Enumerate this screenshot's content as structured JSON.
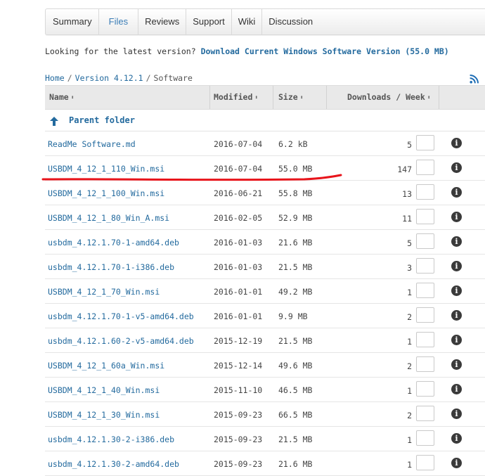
{
  "tabs": [
    {
      "label": "Summary",
      "active": false
    },
    {
      "label": "Files",
      "active": true
    },
    {
      "label": "Reviews",
      "active": false
    },
    {
      "label": "Support",
      "active": false
    },
    {
      "label": "Wiki",
      "active": false
    },
    {
      "label": "Discussion",
      "active": false
    }
  ],
  "latest": {
    "prefix": "Looking for the latest version?",
    "link": "Download Current Windows Software Version (55.0 MB)"
  },
  "breadcrumb": {
    "home": "Home",
    "version": "Version 4.12.1",
    "current": "Software"
  },
  "table": {
    "headers": {
      "name": "Name",
      "modified": "Modified",
      "size": "Size",
      "downloads": "Downloads / Week",
      "sort_glyph": "⬍"
    },
    "parent_label": "Parent folder",
    "rows": [
      {
        "name": "ReadMe Software.md",
        "modified": "2016-07-04",
        "size": "6.2 kB",
        "downloads": "5"
      },
      {
        "name": "USBDM_4_12_1_110_Win.msi",
        "modified": "2016-07-04",
        "size": "55.0 MB",
        "downloads": "147"
      },
      {
        "name": "USBDM_4_12_1_100_Win.msi",
        "modified": "2016-06-21",
        "size": "55.8 MB",
        "downloads": "13"
      },
      {
        "name": "USBDM_4_12_1_80_Win_A.msi",
        "modified": "2016-02-05",
        "size": "52.9 MB",
        "downloads": "11"
      },
      {
        "name": "usbdm_4.12.1.70-1-amd64.deb",
        "modified": "2016-01-03",
        "size": "21.6 MB",
        "downloads": "5"
      },
      {
        "name": "usbdm_4.12.1.70-1-i386.deb",
        "modified": "2016-01-03",
        "size": "21.5 MB",
        "downloads": "3"
      },
      {
        "name": "USBDM_4_12_1_70_Win.msi",
        "modified": "2016-01-01",
        "size": "49.2 MB",
        "downloads": "1"
      },
      {
        "name": "usbdm_4.12.1.70-1-v5-amd64.deb",
        "modified": "2016-01-01",
        "size": "9.9 MB",
        "downloads": "2"
      },
      {
        "name": "usbdm_4.12.1.60-2-v5-amd64.deb",
        "modified": "2015-12-19",
        "size": "21.5 MB",
        "downloads": "1"
      },
      {
        "name": "USBDM_4_12_1_60a_Win.msi",
        "modified": "2015-12-14",
        "size": "49.6 MB",
        "downloads": "2"
      },
      {
        "name": "USBDM_4_12_1_40_Win.msi",
        "modified": "2015-11-10",
        "size": "46.5 MB",
        "downloads": "1"
      },
      {
        "name": "USBDM_4_12_1_30_Win.msi",
        "modified": "2015-09-23",
        "size": "66.5 MB",
        "downloads": "2"
      },
      {
        "name": "usbdm_4.12.1.30-2-i386.deb",
        "modified": "2015-09-23",
        "size": "21.5 MB",
        "downloads": "1"
      },
      {
        "name": "usbdm_4.12.1.30-2-amd64.deb",
        "modified": "2015-09-23",
        "size": "21.6 MB",
        "downloads": "1"
      }
    ]
  },
  "colors": {
    "link": "#236a9e",
    "active_tab": "#3b7db6",
    "annotation_red": "#e8141b"
  },
  "icons": {
    "parent": "arrow-up-icon",
    "rss": "rss-icon",
    "info": "info-icon",
    "info_glyph": "i"
  }
}
